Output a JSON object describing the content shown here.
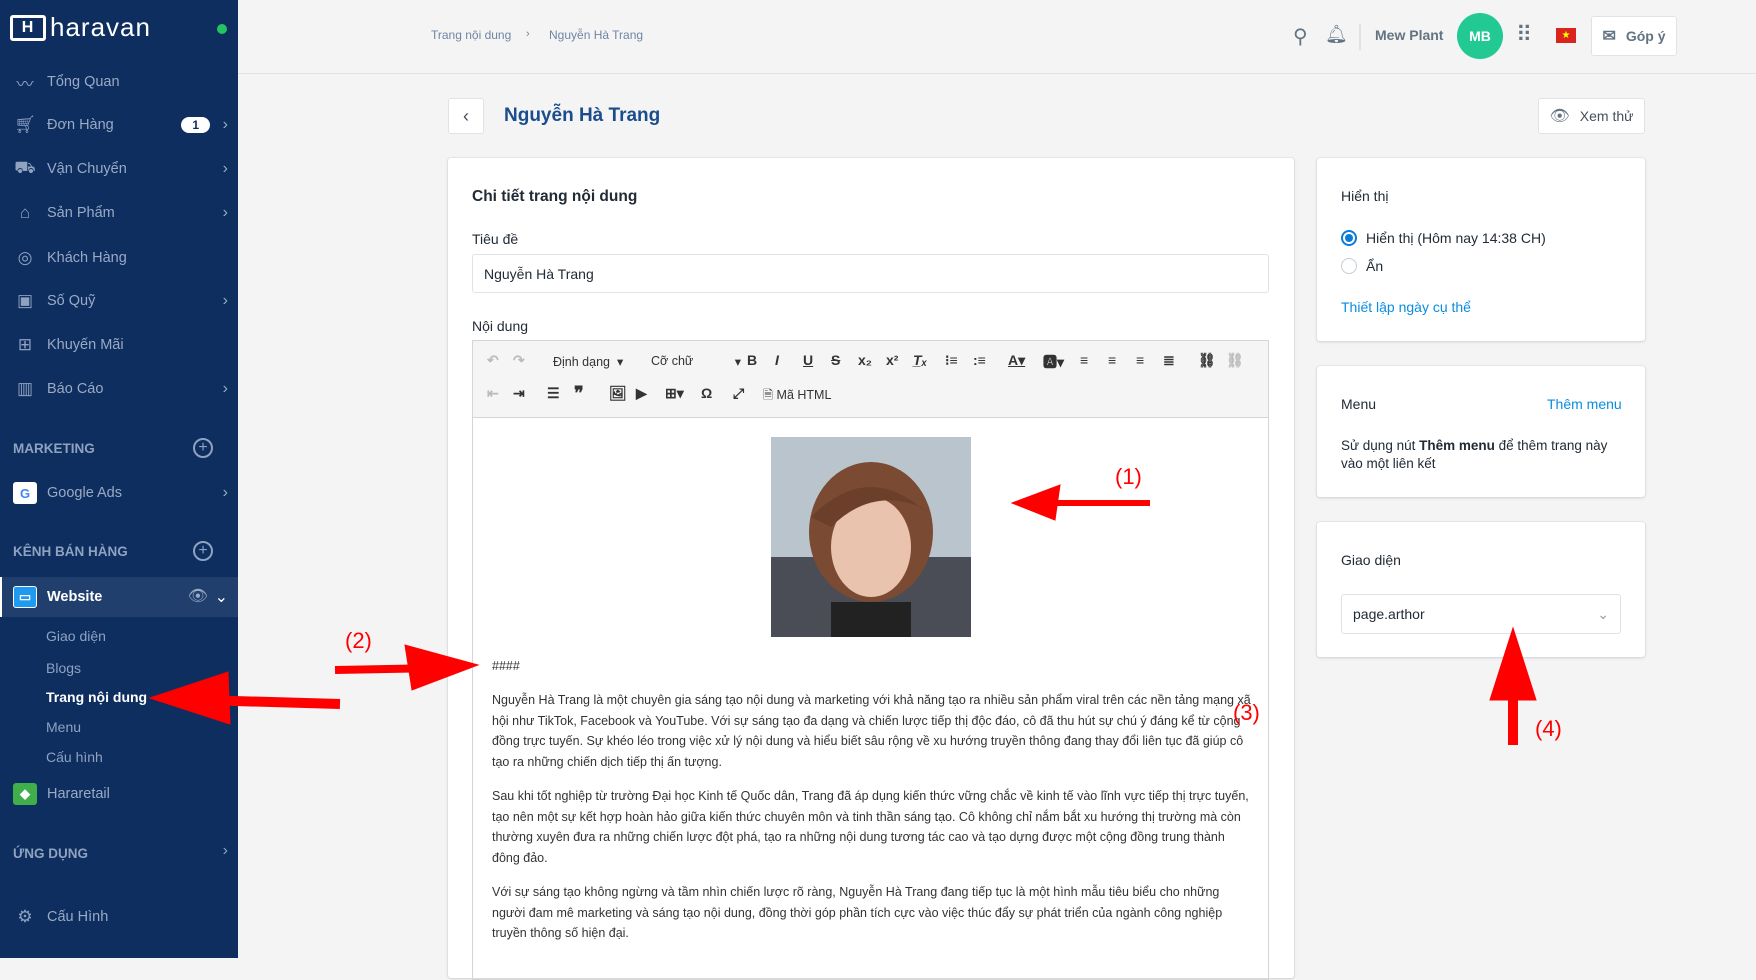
{
  "sidebar": {
    "brand": "haravan",
    "items": [
      {
        "label": "Tổng Quan",
        "icon": "chart-line-icon"
      },
      {
        "label": "Đơn Hàng",
        "icon": "cart-icon",
        "badge": "1"
      },
      {
        "label": "Vận Chuyển",
        "icon": "truck-icon"
      },
      {
        "label": "Sản Phẩm",
        "icon": "tag-icon"
      },
      {
        "label": "Khách Hàng",
        "icon": "user-circle-icon"
      },
      {
        "label": "Số Quỹ",
        "icon": "cash-box-icon"
      },
      {
        "label": "Khuyến Mãi",
        "icon": "gift-icon"
      },
      {
        "label": "Báo Cáo",
        "icon": "report-icon"
      }
    ],
    "marketing_heading": "MARKETING",
    "google_ads": "Google Ads",
    "sales_channel_heading": "KÊNH BÁN HÀNG",
    "website": "Website",
    "website_sub": [
      "Giao diện",
      "Blogs",
      "Trang nội dung",
      "Menu",
      "Cấu hình"
    ],
    "hararetail": "Hararetail",
    "apps_heading": "ỨNG DỤNG",
    "settings": "Cấu Hình"
  },
  "topbar": {
    "breadcrumb": [
      "Trang nội dung",
      "Nguyễn Hà Trang"
    ],
    "store": "Mew Plant",
    "avatar": "MB",
    "feedback": "Góp ý"
  },
  "page": {
    "title": "Nguyễn Hà Trang",
    "preview": "Xem thử"
  },
  "detail": {
    "heading": "Chi tiết trang nội dung",
    "title_label": "Tiêu đề",
    "title_value": "Nguyễn Hà Trang",
    "content_label": "Nội dung",
    "toolbar": {
      "format": "Định dạng",
      "font_size": "Cỡ chữ",
      "html": "Mã HTML"
    },
    "heading_marker": "####",
    "paragraphs": [
      "Nguyễn Hà Trang là một chuyên gia sáng tạo nội dung và marketing với khả năng tạo ra nhiều sản phẩm viral trên các nền tảng mạng xã hội như TikTok, Facebook và YouTube. Với sự sáng tạo đa dạng và chiến lược tiếp thị độc đáo, cô đã thu hút sự chú ý đáng kể từ cộng đồng trực tuyến. Sự khéo léo trong việc xử lý nội dung và hiểu biết sâu rộng về xu hướng truyền thông đang thay đổi liên tục đã giúp cô tạo ra những chiến dịch tiếp thị ấn tượng.",
      "Sau khi tốt nghiệp từ trường Đại học Kinh tế Quốc dân, Trang đã áp dụng kiến thức vững chắc về kinh tế vào lĩnh vực tiếp thị trực tuyến, tạo nên một sự kết hợp hoàn hảo giữa kiến thức chuyên môn và tinh thần sáng tạo. Cô không chỉ nắm bắt xu hướng thị trường mà còn thường xuyên đưa ra những chiến lược đột phá, tạo ra những nội dung tương tác cao và tạo dựng được một cộng đồng trung thành đông đảo.",
      "Với sự sáng tạo không ngừng và tầm nhìn chiến lược rõ ràng, Nguyễn Hà Trang đang tiếp tục là một hình mẫu tiêu biểu cho những người đam mê marketing và sáng tạo nội dung, đồng thời góp phần tích cực vào việc thúc đẩy sự phát triển của ngành công nghiệp truyền thông số hiện đại."
    ]
  },
  "visibility": {
    "heading": "Hiển thị",
    "option_show": "Hiển thị (Hôm nay 14:38 CH)",
    "option_hide": "Ẩn",
    "set_date": "Thiết lập ngày cụ thể"
  },
  "menu_card": {
    "heading": "Menu",
    "add": "Thêm menu",
    "desc_pre": "Sử dụng nút ",
    "desc_bold": "Thêm menu",
    "desc_post": " để thêm trang này vào một liên kết"
  },
  "theme_card": {
    "heading": "Giao diện",
    "value": "page.arthor"
  },
  "annotations": [
    "(1)",
    "(2)",
    "(3)",
    "(4)"
  ],
  "colors": {
    "sidebar": "#0d2e5f",
    "accent": "#0a8de0",
    "avatar": "#23c993",
    "annotation": "#ff0000"
  }
}
